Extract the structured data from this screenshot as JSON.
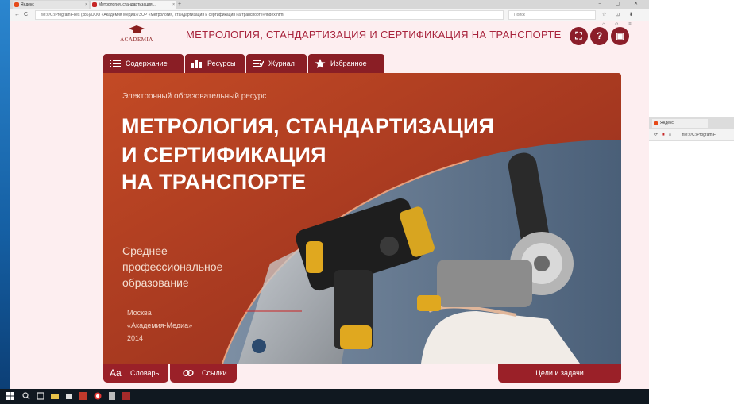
{
  "browser": {
    "tabs": [
      {
        "label": "Яндекс"
      },
      {
        "label": "Метрология, стандартизация..."
      }
    ],
    "new_tab": "+",
    "window_controls": "– ▢ ✕",
    "nav_back": "←",
    "nav_reload": "C",
    "url": "file:///C:/Program Files (x86)/OOO «Академия Медиа»/ЭОР «Метрология, стандартизация и сертификация на транспорте»/index.html",
    "search_placeholder": "Поиск",
    "toolbar_icons": "☆ ⊡ ⬇ ⌂ ☺ ≡"
  },
  "header": {
    "logo_text": "ACADEMIA",
    "title": "МЕТРОЛОГИЯ, СТАНДАРТИЗАЦИЯ И СЕРТИФИКАЦИЯ НА ТРАНСПОРТЕ",
    "fullscreen": "⛶",
    "help": "?",
    "save": "▣"
  },
  "nav_tabs": [
    {
      "label": "Содержание",
      "icon": "list-icon"
    },
    {
      "label": "Ресурсы",
      "icon": "bar-chart-icon"
    },
    {
      "label": "Журнал",
      "icon": "journal-icon"
    },
    {
      "label": "Избранное",
      "icon": "star-icon"
    }
  ],
  "banner": {
    "resource_type": "Электронный образовательный ресурс",
    "title_lines": [
      "МЕТРОЛОГИЯ, СТАНДАРТИЗАЦИЯ",
      "И СЕРТИФИКАЦИЯ",
      "НА ТРАНСПОРТЕ"
    ],
    "level_lines": [
      "Среднее",
      "профессиональное",
      "образование"
    ],
    "publisher_lines": [
      "Москва",
      "«Академия-Медиа»",
      "2014"
    ]
  },
  "bottom": {
    "glossary_icon": "Aa",
    "glossary": "Словарь",
    "links": "Ссылки",
    "goals": "Цели и задачи"
  },
  "side_window": {
    "tab": "Яндекс",
    "url": "file:///C:/Program F"
  },
  "colors": {
    "accent": "#8a1e25",
    "title": "#a8233c",
    "banner": "#b43e22",
    "page_bg": "#fdeef0"
  }
}
